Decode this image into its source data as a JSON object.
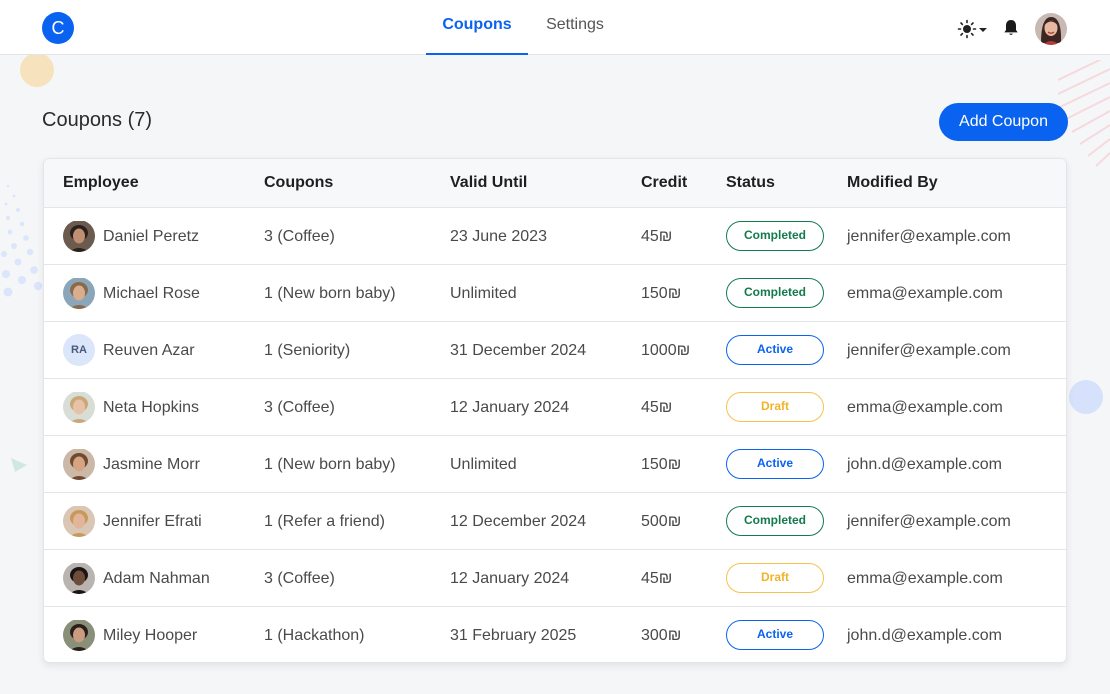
{
  "app": {
    "logo_letter": "C",
    "nav": [
      {
        "label": "Coupons",
        "active": true
      },
      {
        "label": "Settings",
        "active": false
      }
    ],
    "icons": [
      "sun-icon",
      "chevron-down-icon",
      "bell-icon"
    ],
    "accent": "#0a63f0"
  },
  "page": {
    "title": "Coupons (7)",
    "add_button": "Add Coupon"
  },
  "table": {
    "columns": [
      "Employee",
      "Coupons",
      "Valid Until",
      "Credit",
      "Status",
      "Modified By"
    ],
    "rows": [
      {
        "employee": "Daniel Peretz",
        "coupons": "3 (Coffee)",
        "valid_until": "23 June 2023",
        "credit": "45₪",
        "status": "Completed",
        "status_type": "completed",
        "modified_by": "jennifer@example.com",
        "avatar": "photo"
      },
      {
        "employee": "Michael Rose",
        "coupons": "1 (New born baby)",
        "valid_until": "Unlimited",
        "credit": "150₪",
        "status": "Completed",
        "status_type": "completed",
        "modified_by": "emma@example.com",
        "avatar": "photo"
      },
      {
        "employee": "Reuven Azar",
        "coupons": "1 (Seniority)",
        "valid_until": "31 December 2024",
        "credit": "1000₪",
        "status": "Active",
        "status_type": "active",
        "modified_by": "jennifer@example.com",
        "avatar": "RA"
      },
      {
        "employee": "Neta Hopkins",
        "coupons": "3 (Coffee)",
        "valid_until": "12 January 2024",
        "credit": "45₪",
        "status": "Draft",
        "status_type": "draft",
        "modified_by": "emma@example.com",
        "avatar": "photo"
      },
      {
        "employee": "Jasmine Morr",
        "coupons": "1 (New born baby)",
        "valid_until": "Unlimited",
        "credit": "150₪",
        "status": "Active",
        "status_type": "active",
        "modified_by": "john.d@example.com",
        "avatar": "photo"
      },
      {
        "employee": "Jennifer Efrati",
        "coupons": "1 (Refer a friend)",
        "valid_until": "12 December 2024",
        "credit": "500₪",
        "status": "Completed",
        "status_type": "completed",
        "modified_by": "jennifer@example.com",
        "avatar": "photo"
      },
      {
        "employee": "Adam Nahman",
        "coupons": "3 (Coffee)",
        "valid_until": "12 January 2024",
        "credit": "45₪",
        "status": "Draft",
        "status_type": "draft",
        "modified_by": "emma@example.com",
        "avatar": "photo"
      },
      {
        "employee": "Miley Hooper",
        "coupons": "1 (Hackathon)",
        "valid_until": "31 February 2025",
        "credit": "300₪",
        "status": "Active",
        "status_type": "active",
        "modified_by": "john.d@example.com",
        "avatar": "photo"
      }
    ]
  }
}
